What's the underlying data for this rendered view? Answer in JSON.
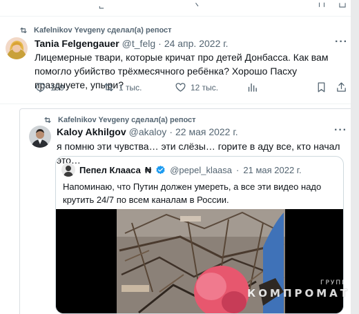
{
  "repost1": {
    "text": "Kafelnikov Yevgeny сделал(а) репост"
  },
  "tweet1": {
    "name": "Tania Felgengauer",
    "handle": "@t_felg",
    "dot": "·",
    "date": "24 апр. 2022 г.",
    "more": "···",
    "body": "Лицемерные твари, которые кричат про детей Донбасса. Как вам помогло убийство трёхмесячного ребёнка? Хорошо Пасху празднуете, упыри?",
    "replies": "159",
    "reposts": "1 тыс.",
    "likes": "12 тыс."
  },
  "repost2": {
    "text": "Kafelnikov Yevgeny сделал(а) репост"
  },
  "tweet2": {
    "name": "Kaloy Akhilgov",
    "handle": "@akaloy",
    "dot": "·",
    "date": "22 мая 2022 г.",
    "more": "···",
    "body": "я помню эти чувства… эти слёзы… горите в аду все, кто начал это…"
  },
  "quote": {
    "name": "Пепел Клааса",
    "name_mark": "₦",
    "handle": "@pepel_klaasa",
    "dot": "·",
    "date": "21 мая 2022 г.",
    "body": "Напоминаю, что Путин должен умереть, а все эти видео надо крутить 24/7 по всем каналам в России."
  },
  "watermark": {
    "small": "ГРУППА",
    "big": "КОМПРОМАТ"
  },
  "colors": {
    "text": "#0f1419",
    "muted": "#536471",
    "verified": "#1d9bf0",
    "border": "#cfd9de"
  },
  "icons": [
    "repost-icon",
    "reply-icon",
    "like-icon",
    "views-icon",
    "bookmark-icon",
    "share-icon",
    "verified-icon",
    "more-icon"
  ]
}
